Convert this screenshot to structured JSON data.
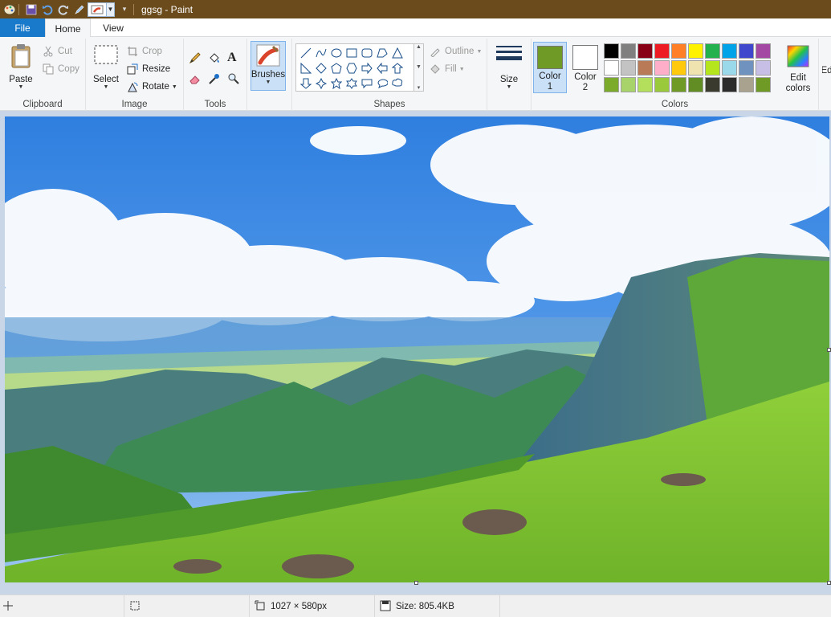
{
  "window": {
    "title": "ggsg - Paint"
  },
  "tabs": {
    "file": "File",
    "home": "Home",
    "view": "View"
  },
  "clipboard": {
    "paste": "Paste",
    "cut": "Cut",
    "copy": "Copy",
    "label": "Clipboard"
  },
  "image": {
    "select": "Select",
    "crop": "Crop",
    "resize": "Resize",
    "rotate": "Rotate",
    "label": "Image"
  },
  "tools": {
    "label": "Tools",
    "text_tool": "A"
  },
  "brushes": {
    "label": "Brushes"
  },
  "shapes": {
    "outline": "Outline",
    "fill": "Fill",
    "label": "Shapes"
  },
  "size": {
    "label": "Size"
  },
  "colors": {
    "color1": "Color",
    "color1_num": "1",
    "color2": "Color",
    "color2_num": "2",
    "edit": "Edit",
    "edit2": "colors",
    "label": "Colors",
    "color1_value": "#6f9a25",
    "color2_value": "#ffffff",
    "palette": [
      "#000000",
      "#7f7f7f",
      "#880015",
      "#ed1c24",
      "#ff7f27",
      "#fff200",
      "#22b14c",
      "#00a2e8",
      "#3f48cc",
      "#a349a4",
      "#ffffff",
      "#c3c3c3",
      "#b97a57",
      "#ffaec9",
      "#ffc90e",
      "#efe4b0",
      "#b5e61d",
      "#99d9ea",
      "#7092be",
      "#c8bfe7",
      "#7cab2b",
      "#a8d26a",
      "#b3df5c",
      "#9ac93c",
      "#6f9a25",
      "#628d25",
      "#3a3a2e",
      "#2b2b2b",
      "#a9a28e",
      "#6f9a25"
    ]
  },
  "edit_paint": {
    "label": "Ed"
  },
  "status": {
    "dimensions": "1027 × 580px",
    "size": "Size: 805.4KB"
  }
}
